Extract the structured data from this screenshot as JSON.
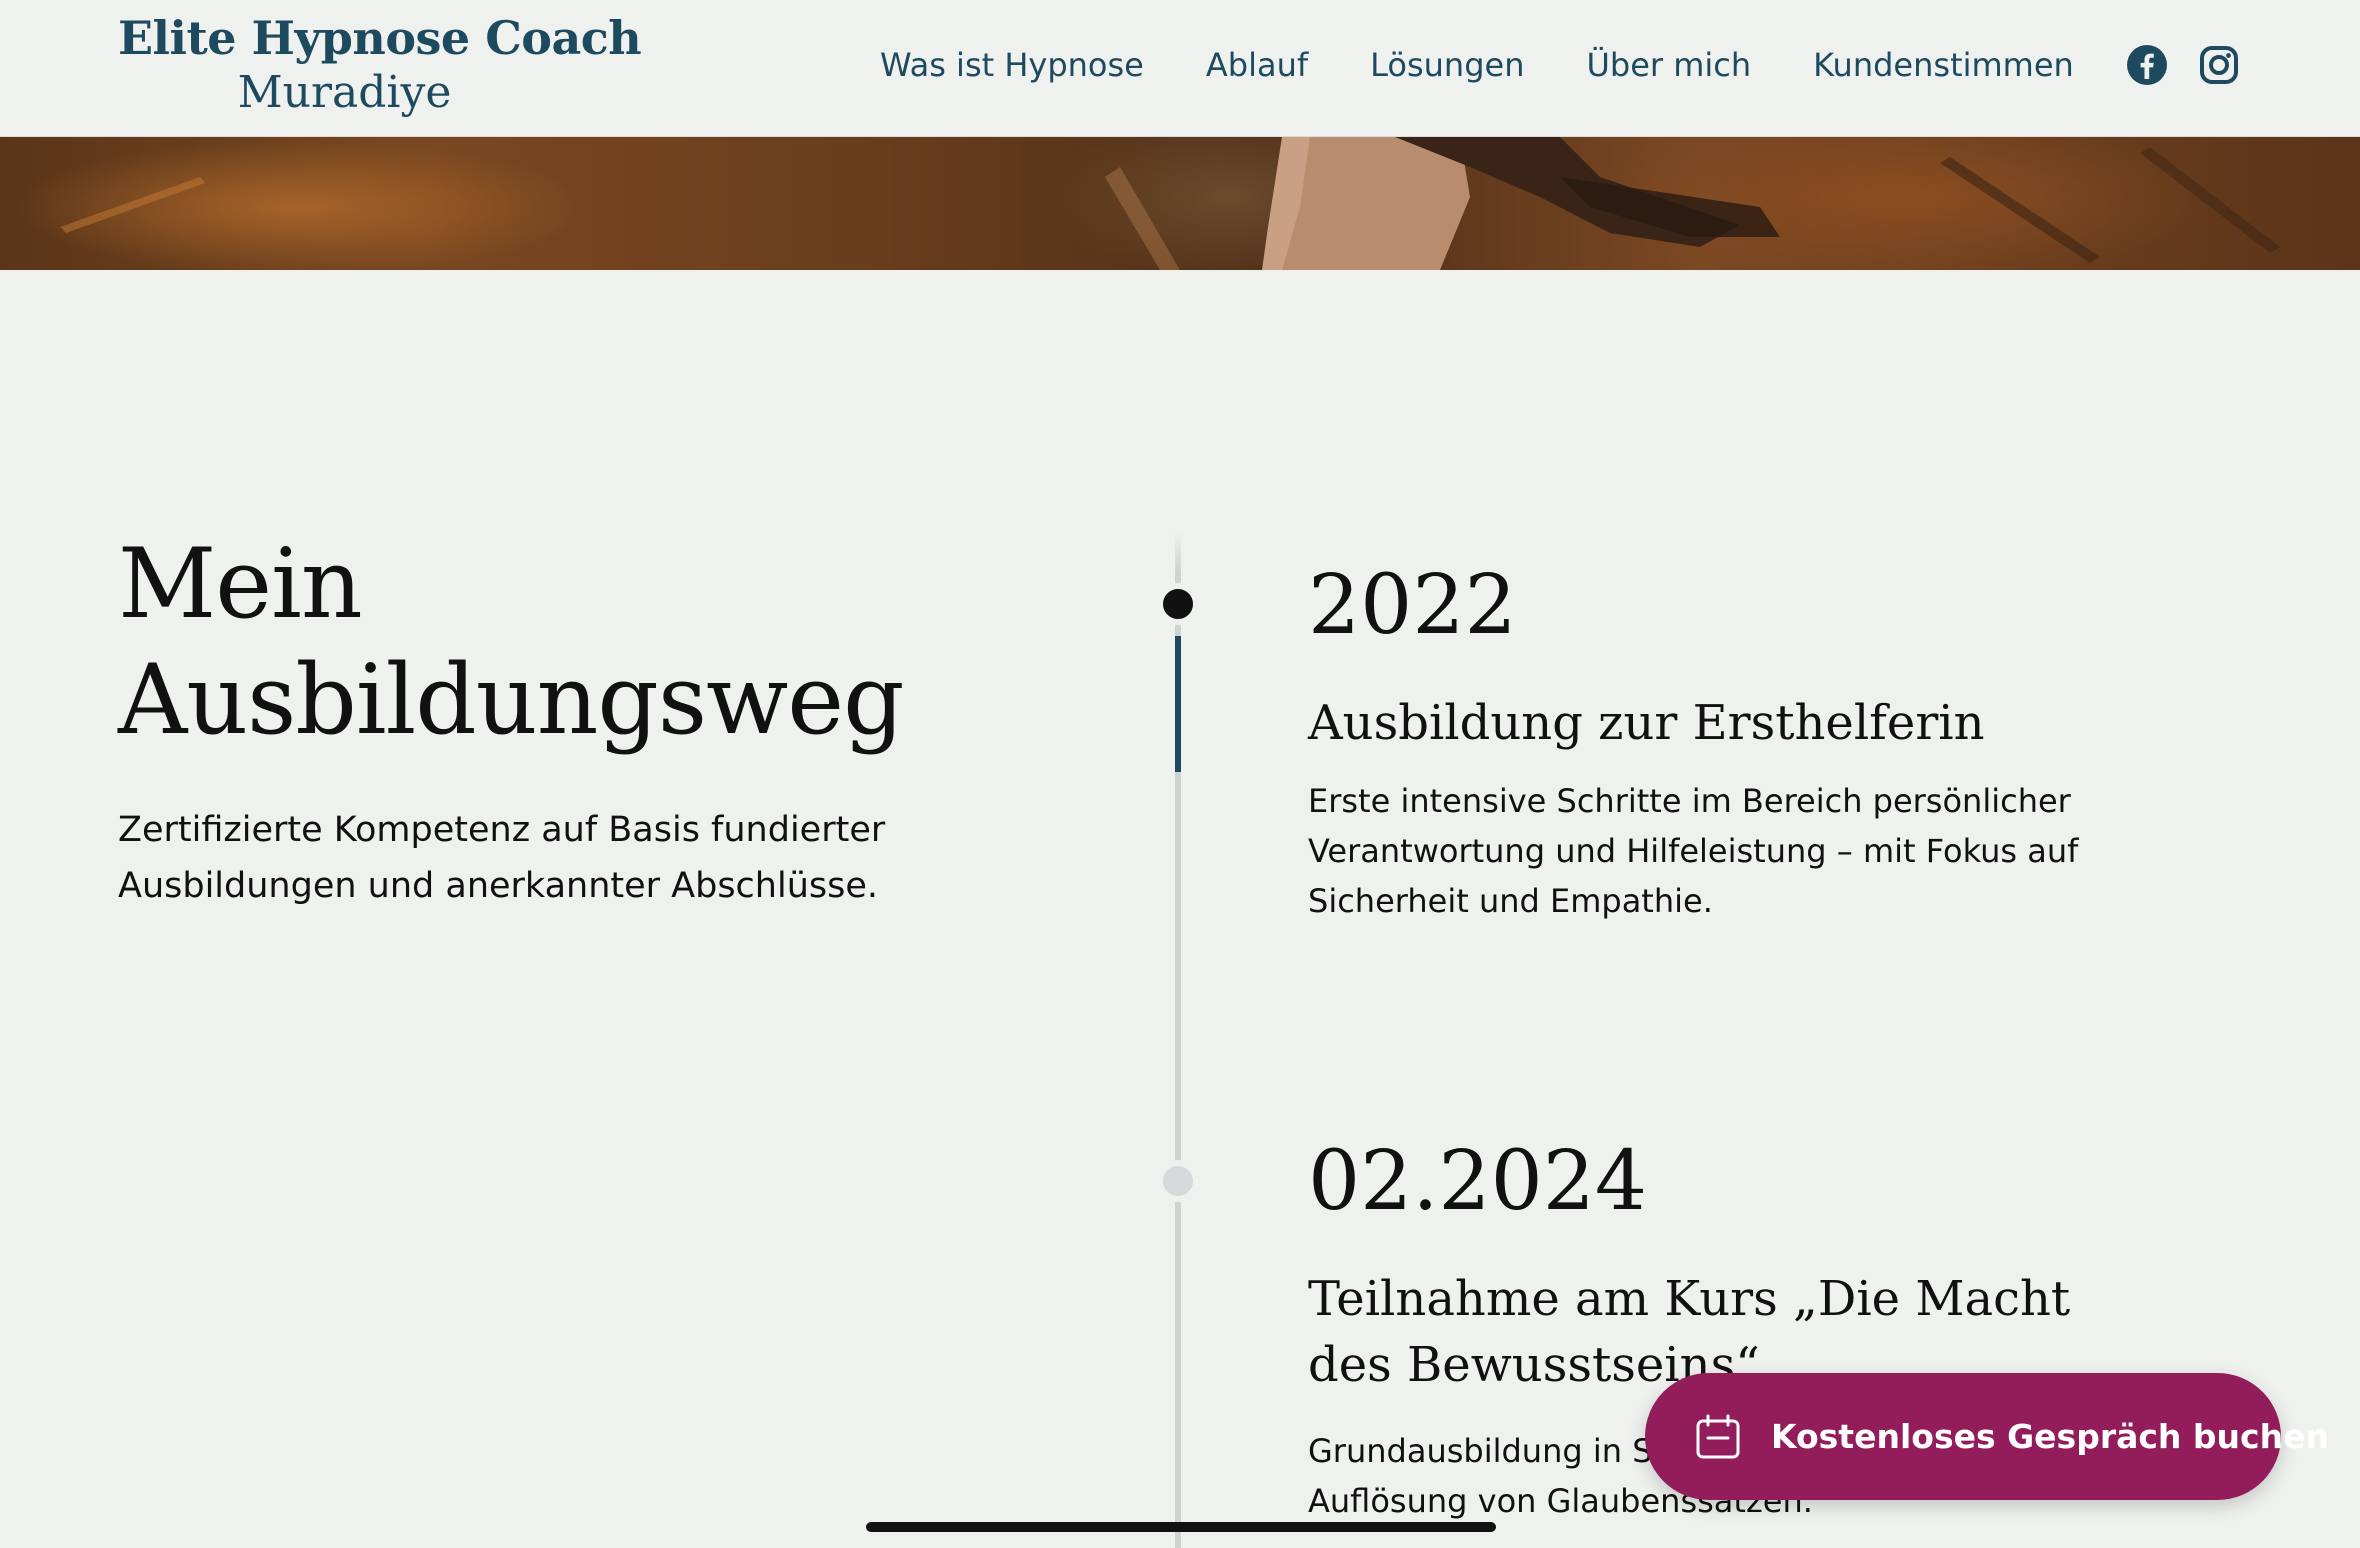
{
  "header": {
    "brand": {
      "line1": "Elite Hypnose Coach",
      "line2": "Muradiye"
    },
    "nav": [
      {
        "label": "Was ist Hypnose"
      },
      {
        "label": "Ablauf"
      },
      {
        "label": "Lösungen"
      },
      {
        "label": "Über mich"
      },
      {
        "label": "Kundenstimmen"
      }
    ],
    "social": [
      {
        "icon": "facebook-icon"
      },
      {
        "icon": "instagram-icon"
      }
    ]
  },
  "section": {
    "title_line1": "Mein",
    "title_line2": "Ausbildungsweg",
    "subtitle": "Zertifizierte Kompetenz auf Basis fundierter Ausbildungen und anerkannter Abschlüsse."
  },
  "timeline": [
    {
      "date": "2022",
      "title": "Ausbildung zur Ersthelferin",
      "text": "Erste intensive Schritte im Bereich persönlicher Verantwortung und Hilfeleistung – mit Fokus auf Sicherheit und Empathie.",
      "active": true
    },
    {
      "date": "02.2024",
      "title": "Teilnahme am Kurs „Die Macht des Bewusstseins“",
      "text_visible_start": "Grundausbildung in Sel",
      "text_visible_end": "Auflösung von Glaubenssätzen.",
      "active": false
    }
  ],
  "cta": {
    "label": "Kostenloses Gespräch buchen",
    "icon": "calendar-icon"
  },
  "colors": {
    "brand": "#1e4a60",
    "background": "#eff1ef",
    "cta": "#931d5a",
    "timeline_inactive": "#d7dadb"
  }
}
